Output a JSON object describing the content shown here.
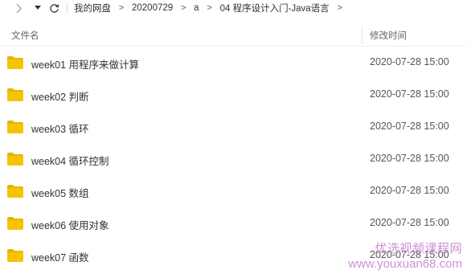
{
  "navbar": {
    "forward_icon": "chevron-right-icon",
    "history_icon": "caret-down-icon",
    "refresh_icon": "refresh-icon",
    "breadcrumb": [
      "我的网盘",
      "20200729",
      "a",
      "04 程序设计入门-Java语言"
    ],
    "separator": ">"
  },
  "columns": {
    "name": "文件名",
    "modified": "修改时间"
  },
  "files": [
    {
      "name": "week01 用程序来做计算",
      "modified": "2020-07-28 15:00",
      "icon": "folder-icon"
    },
    {
      "name": "week02 判断",
      "modified": "2020-07-28 15:00",
      "icon": "folder-icon"
    },
    {
      "name": "week03 循环",
      "modified": "2020-07-28 15:00",
      "icon": "folder-icon"
    },
    {
      "name": "week04 循环控制",
      "modified": "2020-07-28 15:00",
      "icon": "folder-icon"
    },
    {
      "name": "week05 数组",
      "modified": "2020-07-28 15:00",
      "icon": "folder-icon"
    },
    {
      "name": "week06 使用对象",
      "modified": "2020-07-28 15:00",
      "icon": "folder-icon"
    },
    {
      "name": "week07 函数",
      "modified": "2020-07-28 15:00",
      "icon": "folder-icon"
    }
  ],
  "watermark": {
    "line1": "优选视频课程网",
    "line2": "www.youxuan68.com"
  },
  "colors": {
    "folder": "#f5c400",
    "folder_back": "#e8b400",
    "watermark": "#c77bd0"
  }
}
